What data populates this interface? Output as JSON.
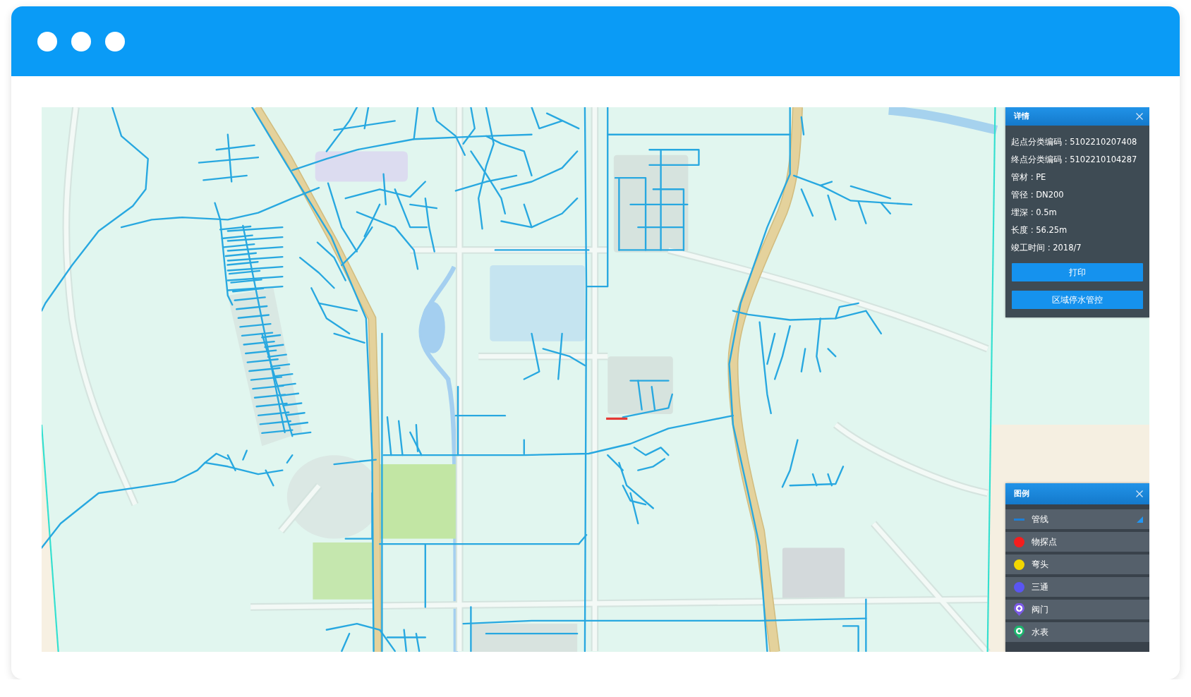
{
  "details_panel": {
    "title": "详情",
    "fields": [
      "起点分类编码 : 5102210207408",
      "终点分类编码 : 5102210104287",
      "管材 : PE",
      "管径 : DN200",
      "埋深 : 0.5m",
      "长度 : 56.25m",
      "竣工时间 : 2018/7"
    ],
    "buttons": [
      "打印",
      "区域停水管控"
    ]
  },
  "legend_panel": {
    "title": "图例",
    "items": [
      {
        "kind": "line",
        "label": "管线",
        "color": "#1e7fd6",
        "checked": true
      },
      {
        "kind": "dot",
        "label": "物探点",
        "color": "#f51d1d",
        "checked": false
      },
      {
        "kind": "dot",
        "label": "弯头",
        "color": "#f2d600",
        "checked": false
      },
      {
        "kind": "dot",
        "label": "三通",
        "color": "#5a55f2",
        "checked": false
      },
      {
        "kind": "pin",
        "label": "阀门",
        "color": "#7b5ae6",
        "checked": false
      },
      {
        "kind": "pin",
        "label": "水表",
        "color": "#1db56f",
        "checked": false
      }
    ]
  }
}
